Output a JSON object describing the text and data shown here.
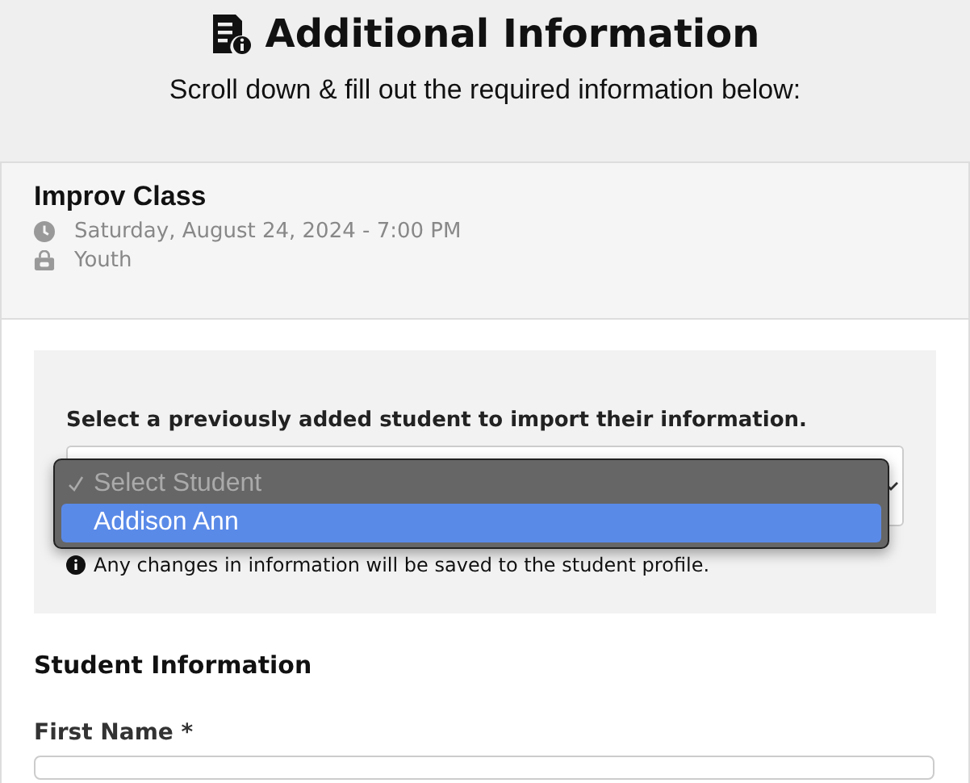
{
  "header": {
    "title": "Additional Information",
    "subtitle": "Scroll down & fill out the required information below:"
  },
  "event": {
    "name": "Improv Class",
    "details": [
      {
        "kind": "time",
        "text": "Saturday, August 24, 2024 - 7:00 PM"
      },
      {
        "kind": "category",
        "text": "Youth"
      }
    ]
  },
  "import": {
    "label": "Select a previously added student to import their information.",
    "dropdown": {
      "options": [
        {
          "label": "Select Student",
          "checked": true,
          "disabled": true,
          "selected": false
        },
        {
          "label": "Addison Ann",
          "checked": false,
          "disabled": false,
          "selected": true
        }
      ]
    },
    "note": "Any changes in information will be saved to the student profile."
  },
  "student_section": {
    "title": "Student Information",
    "fields": [
      {
        "label": "First Name *"
      }
    ]
  }
}
